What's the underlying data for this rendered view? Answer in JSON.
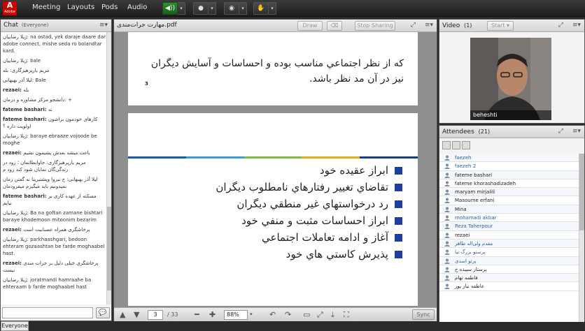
{
  "topbar": {
    "logo": "A",
    "logo_sub": "Adobe",
    "menus": [
      "Meeting",
      "Layouts",
      "Pods",
      "Audio"
    ]
  },
  "chat": {
    "title": "Chat",
    "scope": "(Everyone)",
    "tab": "Everyone",
    "messages": [
      {
        "sender": "",
        "text": "ژیلا رضاییان: na ostad, yek daraje daare dar adobe connect, mishe seda ro bolandtar kard."
      },
      {
        "sender": "",
        "text": "ژیلا رضاییان: bale"
      },
      {
        "sender": "",
        "text": "مریم یارپرهیزگاری: بله"
      },
      {
        "sender": "",
        "text": "لیلا آذر بهبهانی: Bale"
      },
      {
        "sender": "rezaei:",
        "text": "بله"
      },
      {
        "sender": "",
        "text": "دانشجو مرکز مشاوره و درمان: +"
      },
      {
        "sender": "fateme bashari:",
        "text": "نه"
      },
      {
        "sender": "fateme bashari:",
        "text": "کارهای خودمون براشون اولویت داره ؟"
      },
      {
        "sender": "",
        "text": "ژیلا رضاییان: baraye ebraaze vojoode be moghe"
      },
      {
        "sender": "rezaei:",
        "text": "باعث میشه بعدش پشیمون نشیم"
      },
      {
        "sender": "",
        "text": "مریم یارپرهیزگاری: جاوابطاتمان ؛ زود در زندگی‌گان نمایان شود کند زود م"
      },
      {
        "sender": "",
        "text": "لیلا آذر بهبهانی: ح نیروا وپشتیرینا نه گفتن زمان نمیدونیم باید میگیرم میفرودمان"
      },
      {
        "sender": "fateme bashari:",
        "text": "مسکنه از عهده کاری بر نیایم"
      },
      {
        "sender": "",
        "text": "ژیلا رضاییان: Ba na goftan zamane bishtari baraye khodemoon mitoonim bezarim"
      },
      {
        "sender": "rezaei:",
        "text": "پرخاشگری همراه عصبانیت است"
      },
      {
        "sender": "",
        "text": "ژیلا رضاییان: parkhaashgari, bedoon ehteram gozaashtan be farde moghaabel hast."
      },
      {
        "sender": "rezaei:",
        "text": "پرخاشگری خیلی دلیل بر جرات مندی نیست"
      },
      {
        "sender": "",
        "text": "ژیلا رضاییان: joratmandi hamraahe ba ehteraam b farde moghaabel hast"
      }
    ]
  },
  "share": {
    "title": "مهارت جرات‌مندی.pdf",
    "draw_label": "Draw",
    "stop_label": "Stop Sharing",
    "page1_text": "كه از نظر اجتماعي مناسب بوده و احساسات و آسايش ديگران نيز در آن مد نظر باشد.",
    "page1_number": "3",
    "bullets": [
      "ابراز عقيده خود",
      "تقاضاي تغيير رفتارهاي نامطلوب ديگران",
      "رد درخواستهاي غير منطقي ديگران",
      "ابراز احساسات مثبت و منفي خود",
      "آغاز و ادامه تعاملات اجتماعي",
      "پذيرش كاستي هاي خود"
    ],
    "current_page": "3",
    "total_pages": "/ 33",
    "zoom": "88%",
    "sync_label": "Sync",
    "colors": {
      "bullet": "#1f3fa0",
      "stripe": [
        "#1a5aa8",
        "#3c9bd6",
        "#7fb84b",
        "#e0b020",
        "#1a3f80"
      ]
    }
  },
  "video": {
    "title": "Video",
    "count": "(1)",
    "start_label": "Start",
    "name": "beheshti"
  },
  "attendees": {
    "title": "Attendees",
    "count": "(21)",
    "list": [
      {
        "name": "faezeh",
        "color": "#2a60b0"
      },
      {
        "name": "faezeh 2",
        "color": "#2a60b0"
      },
      {
        "name": "fateme bashari",
        "color": "#222"
      },
      {
        "name": "fateme khorashadizadeh",
        "color": "#222"
      },
      {
        "name": "maryam mirjalili",
        "color": "#222"
      },
      {
        "name": "Masoume erfani",
        "color": "#222"
      },
      {
        "name": "Mina",
        "color": "#222"
      },
      {
        "name": "mohamadi akbar",
        "color": "#2a60b0"
      },
      {
        "name": "Reza Taherpour",
        "color": "#2a60b0"
      },
      {
        "name": "rezaei",
        "color": "#222"
      },
      {
        "name": "مقدم ولی‌اله ظاهر",
        "color": "#2a60b0"
      },
      {
        "name": "پرستو بزرگ نیا",
        "color": "#2a60b0"
      },
      {
        "name": "پرتو اسدی",
        "color": "#2a60b0"
      },
      {
        "name": "پرستار سپیده ح",
        "color": "#222"
      },
      {
        "name": "فاطمه تهام",
        "color": "#222"
      },
      {
        "name": "عاطفه نیاز پور",
        "color": "#222"
      }
    ]
  }
}
